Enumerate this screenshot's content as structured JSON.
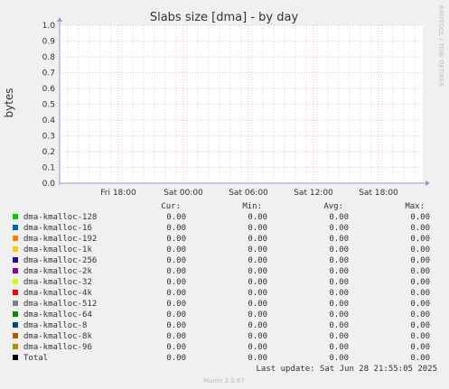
{
  "chart_data": {
    "type": "line",
    "title": "Slabs size [dma] - by day",
    "ylabel": "bytes",
    "ylim": [
      0,
      1
    ],
    "yticks": [
      "0.0",
      "0.1",
      "0.2",
      "0.3",
      "0.4",
      "0.5",
      "0.6",
      "0.7",
      "0.8",
      "0.9",
      "1.0"
    ],
    "xticks": [
      "Fri 18:00",
      "Sat 00:00",
      "Sat 06:00",
      "Sat 12:00",
      "Sat 18:00"
    ],
    "grid": true,
    "legend_headers": {
      "cur": "Cur:",
      "min": "Min:",
      "avg": "Avg:",
      "max": "Max:"
    },
    "series": [
      {
        "name": "dma-kmalloc-128",
        "color": "#00cc00",
        "cur": "0.00",
        "min": "0.00",
        "avg": "0.00",
        "max": "0.00",
        "values": [
          0,
          0,
          0,
          0,
          0
        ]
      },
      {
        "name": "dma-kmalloc-16",
        "color": "#0066b3",
        "cur": "0.00",
        "min": "0.00",
        "avg": "0.00",
        "max": "0.00",
        "values": [
          0,
          0,
          0,
          0,
          0
        ]
      },
      {
        "name": "dma-kmalloc-192",
        "color": "#ff8000",
        "cur": "0.00",
        "min": "0.00",
        "avg": "0.00",
        "max": "0.00",
        "values": [
          0,
          0,
          0,
          0,
          0
        ]
      },
      {
        "name": "dma-kmalloc-1k",
        "color": "#ffcc00",
        "cur": "0.00",
        "min": "0.00",
        "avg": "0.00",
        "max": "0.00",
        "values": [
          0,
          0,
          0,
          0,
          0
        ]
      },
      {
        "name": "dma-kmalloc-256",
        "color": "#330099",
        "cur": "0.00",
        "min": "0.00",
        "avg": "0.00",
        "max": "0.00",
        "values": [
          0,
          0,
          0,
          0,
          0
        ]
      },
      {
        "name": "dma-kmalloc-2k",
        "color": "#990099",
        "cur": "0.00",
        "min": "0.00",
        "avg": "0.00",
        "max": "0.00",
        "values": [
          0,
          0,
          0,
          0,
          0
        ]
      },
      {
        "name": "dma-kmalloc-32",
        "color": "#ccff00",
        "cur": "0.00",
        "min": "0.00",
        "avg": "0.00",
        "max": "0.00",
        "values": [
          0,
          0,
          0,
          0,
          0
        ]
      },
      {
        "name": "dma-kmalloc-4k",
        "color": "#ff0000",
        "cur": "0.00",
        "min": "0.00",
        "avg": "0.00",
        "max": "0.00",
        "values": [
          0,
          0,
          0,
          0,
          0
        ]
      },
      {
        "name": "dma-kmalloc-512",
        "color": "#808080",
        "cur": "0.00",
        "min": "0.00",
        "avg": "0.00",
        "max": "0.00",
        "values": [
          0,
          0,
          0,
          0,
          0
        ]
      },
      {
        "name": "dma-kmalloc-64",
        "color": "#008f00",
        "cur": "0.00",
        "min": "0.00",
        "avg": "0.00",
        "max": "0.00",
        "values": [
          0,
          0,
          0,
          0,
          0
        ]
      },
      {
        "name": "dma-kmalloc-8",
        "color": "#00487d",
        "cur": "0.00",
        "min": "0.00",
        "avg": "0.00",
        "max": "0.00",
        "values": [
          0,
          0,
          0,
          0,
          0
        ]
      },
      {
        "name": "dma-kmalloc-8k",
        "color": "#b35a00",
        "cur": "0.00",
        "min": "0.00",
        "avg": "0.00",
        "max": "0.00",
        "values": [
          0,
          0,
          0,
          0,
          0
        ]
      },
      {
        "name": "dma-kmalloc-96",
        "color": "#b38f00",
        "cur": "0.00",
        "min": "0.00",
        "avg": "0.00",
        "max": "0.00",
        "values": [
          0,
          0,
          0,
          0,
          0
        ]
      },
      {
        "name": "Total",
        "color": "#000000",
        "cur": "0.00",
        "min": "0.00",
        "avg": "0.00",
        "max": "0.00",
        "values": [
          0,
          0,
          0,
          0,
          0
        ]
      }
    ]
  },
  "footer": {
    "last_update": "Last update: Sat Jun 28 21:55:05 2025",
    "version": "Munin 2.0.67"
  },
  "watermark": "RRDTOOL / TOBI OETIKER",
  "colors": {
    "background": "#f0f0f0",
    "plot_background": "#ffffff",
    "grid_minor": "#e0b0b0",
    "grid_major": "#d08080",
    "axis": "#9999cc"
  }
}
